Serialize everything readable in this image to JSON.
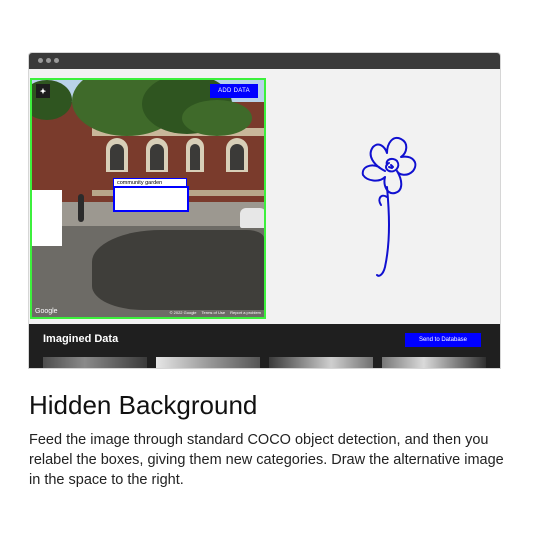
{
  "window": {
    "buttons": {
      "add_data": "ADD DATA",
      "send": "Send to Database"
    },
    "streetview": {
      "label_tag": "community garden",
      "attribution": "Google",
      "footer": [
        "© 2022 Google",
        "Terms of Use",
        "Report a problem"
      ],
      "border_color": "#3cf03c",
      "box_color": "#0000ff"
    },
    "bottombar": {
      "title": "Imagined Data"
    },
    "drawing": {
      "stroke_color": "#1010d0"
    }
  },
  "heading": "Hidden Background",
  "description": "Feed the image through standard COCO object detection, and then you relabel the boxes, giving them new categories. Draw the alternative image in the space to the right.",
  "icons": [
    "window-dot-icon",
    "street-view-logo-icon",
    "flower-sketch"
  ]
}
